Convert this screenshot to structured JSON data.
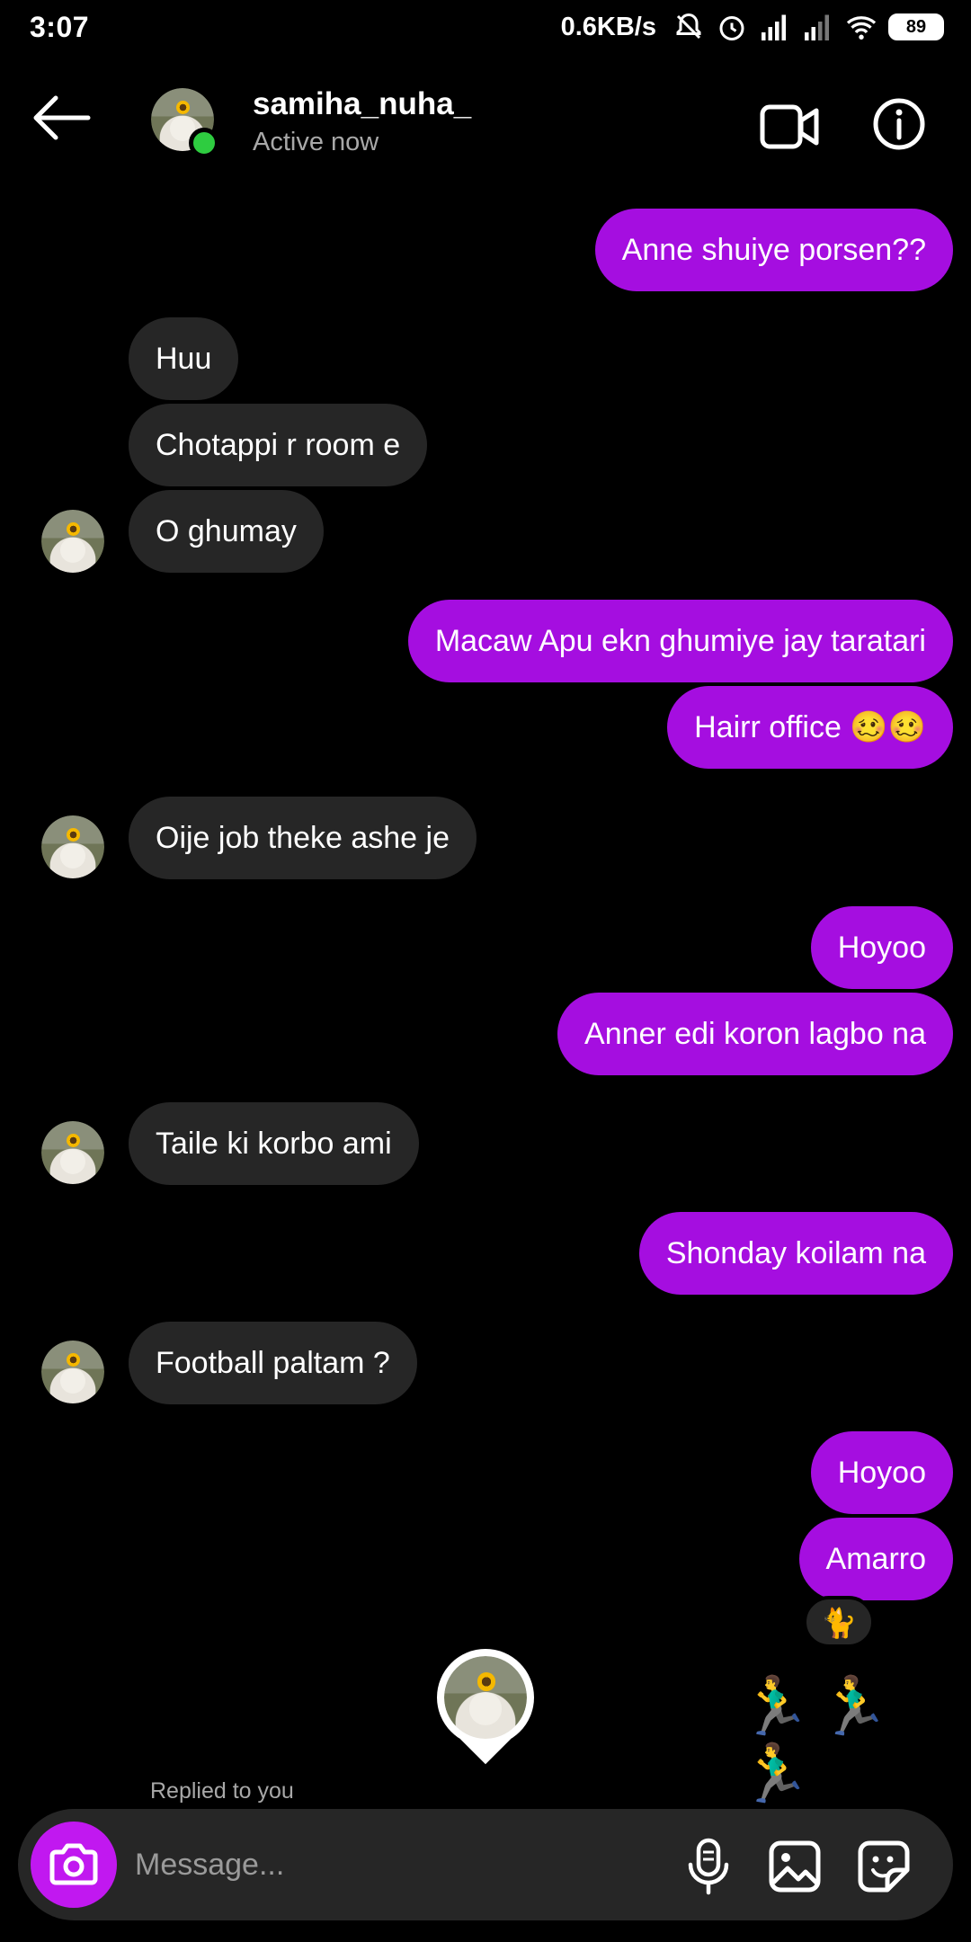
{
  "status_bar": {
    "time": "3:07",
    "speed": "0.6KB/s",
    "battery": "89",
    "icons": [
      "mute-bell-icon",
      "alarm-icon",
      "signal-icon",
      "signal-icon",
      "wifi-icon",
      "battery-icon"
    ]
  },
  "header": {
    "username": "samiha_nuha_",
    "status": "Active now",
    "icons": [
      "back-arrow-icon",
      "video-call-icon",
      "info-icon"
    ]
  },
  "colors": {
    "outgoing_bubble": "#a50ee0",
    "incoming_bubble": "#262626",
    "camera_button": "#c118f0",
    "online_dot": "#2ecc40"
  },
  "messages": [
    {
      "from": "me",
      "text": "Anne shuiye porsen??"
    },
    {
      "from": "them",
      "text": "Huu"
    },
    {
      "from": "them",
      "text": "Chotappi r room e"
    },
    {
      "from": "them",
      "text": "O ghumay"
    },
    {
      "from": "me",
      "text": "Macaw Apu ekn ghumiye jay taratari"
    },
    {
      "from": "me",
      "text": "Hairr office 🥴🥴"
    },
    {
      "from": "them",
      "text": "Oije job theke ashe je"
    },
    {
      "from": "me",
      "text": "Hoyoo"
    },
    {
      "from": "me",
      "text": "Anner edi koron lagbo na"
    },
    {
      "from": "them",
      "text": "Taile ki korbo ami"
    },
    {
      "from": "me",
      "text": "Shonday koilam na"
    },
    {
      "from": "them",
      "text": "Football paltam ?"
    },
    {
      "from": "me",
      "text": "Hoyoo"
    },
    {
      "from": "me",
      "text": "Amarro"
    }
  ],
  "reaction": "🐈",
  "runners": "🏃‍♂️🏃‍♂️🏃‍♂️",
  "replied_label": "Replied to you",
  "composer": {
    "placeholder": "Message...",
    "icons": [
      "camera-icon",
      "microphone-icon",
      "gallery-icon",
      "sticker-icon"
    ]
  }
}
